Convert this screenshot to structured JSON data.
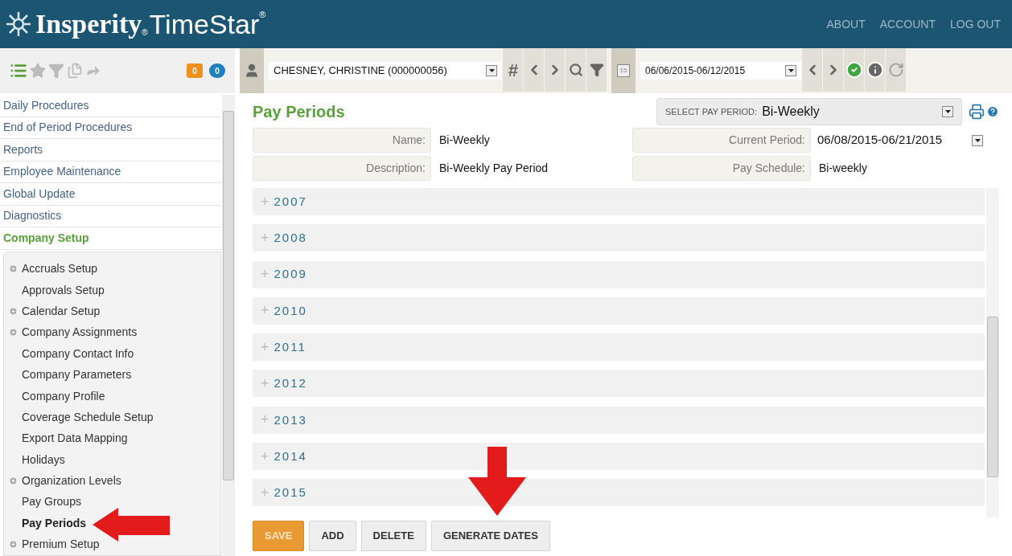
{
  "header": {
    "logo": "Insperity",
    "logo_mark": "®",
    "product": "TimeStar",
    "product_mark": "®",
    "links": [
      "ABOUT",
      "ACCOUNT",
      "LOG OUT"
    ]
  },
  "toolbar": {
    "badges": [
      {
        "kind": "alerts",
        "count": "0"
      },
      {
        "kind": "messages",
        "count": "0"
      }
    ],
    "employee": "CHESNEY, CHRISTINE (000000056)",
    "hash": "#",
    "date_range": "06/06/2015-06/12/2015",
    "calendar_day": "15"
  },
  "sidebar": {
    "items": [
      {
        "label": "Daily Procedures",
        "selected": false
      },
      {
        "label": "End of Period Procedures",
        "selected": false
      },
      {
        "label": "Reports",
        "selected": false
      },
      {
        "label": "Employee Maintenance",
        "selected": false
      },
      {
        "label": "Global Update",
        "selected": false
      },
      {
        "label": "Diagnostics",
        "selected": false
      },
      {
        "label": "Company Setup",
        "selected": true
      }
    ],
    "subitems": [
      {
        "label": "Accruals Setup",
        "kind": "group",
        "selected": false
      },
      {
        "label": "Approvals Setup",
        "kind": "page",
        "selected": false
      },
      {
        "label": "Calendar Setup",
        "kind": "group",
        "selected": false
      },
      {
        "label": "Company Assignments",
        "kind": "group",
        "selected": false
      },
      {
        "label": "Company Contact Info",
        "kind": "page",
        "selected": false
      },
      {
        "label": "Company Parameters",
        "kind": "page",
        "selected": false
      },
      {
        "label": "Company Profile",
        "kind": "page",
        "selected": false
      },
      {
        "label": "Coverage Schedule Setup",
        "kind": "page",
        "selected": false
      },
      {
        "label": "Export Data Mapping",
        "kind": "page",
        "selected": false
      },
      {
        "label": "Holidays",
        "kind": "page",
        "selected": false
      },
      {
        "label": "Organization Levels",
        "kind": "group",
        "selected": false
      },
      {
        "label": "Pay Groups",
        "kind": "page",
        "selected": false
      },
      {
        "label": "Pay Periods",
        "kind": "page",
        "selected": true
      },
      {
        "label": "Premium Setup",
        "kind": "group",
        "selected": false
      }
    ]
  },
  "page": {
    "title": "Pay Periods",
    "select_label": "SELECT PAY PERIOD:",
    "select_value": "Bi-Weekly",
    "fields": [
      {
        "label": "Name:",
        "value": "Bi-Weekly",
        "kind": "text"
      },
      {
        "label": "Current Period:",
        "value": "06/08/2015-06/21/2015",
        "kind": "dropdown"
      },
      {
        "label": "Description:",
        "value": "Bi-Weekly Pay Period",
        "kind": "text"
      },
      {
        "label": "Pay Schedule:",
        "value": "Bi-weekly",
        "kind": "text"
      }
    ],
    "years": [
      {
        "sign": "+",
        "label": "2007",
        "expanded": false
      },
      {
        "sign": "+",
        "label": "2008",
        "expanded": false
      },
      {
        "sign": "+",
        "label": "2009",
        "expanded": false
      },
      {
        "sign": "+",
        "label": "2010",
        "expanded": false
      },
      {
        "sign": "+",
        "label": "2011",
        "expanded": false
      },
      {
        "sign": "+",
        "label": "2012",
        "expanded": false
      },
      {
        "sign": "+",
        "label": "2013",
        "expanded": false
      },
      {
        "sign": "+",
        "label": "2014",
        "expanded": false
      },
      {
        "sign": "+",
        "label": "2015",
        "expanded": false
      }
    ],
    "buttons": [
      {
        "label": "SAVE",
        "kind": "primary"
      },
      {
        "label": "ADD",
        "kind": "default"
      },
      {
        "label": "DELETE",
        "kind": "default"
      },
      {
        "label": "GENERATE DATES",
        "kind": "default"
      }
    ]
  }
}
